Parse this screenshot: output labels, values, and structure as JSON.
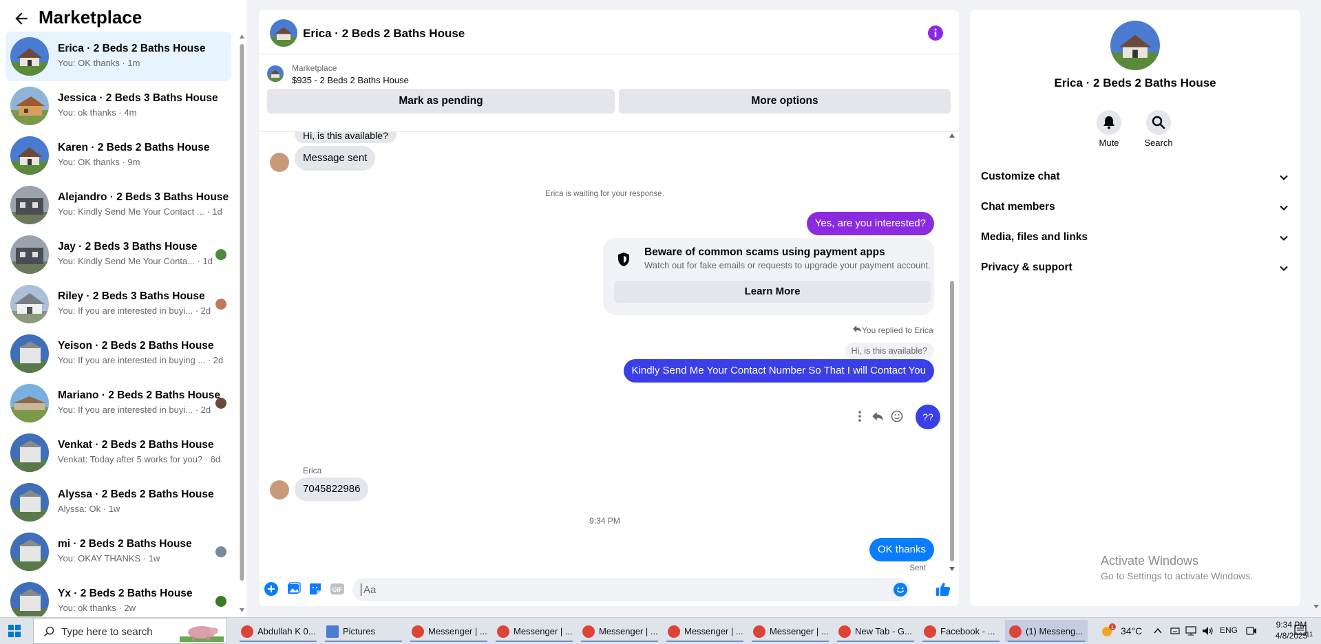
{
  "sidebar": {
    "title": "Marketplace",
    "conversations": [
      {
        "name": "Erica · 2 Beds 2 Baths House",
        "preview": "You: OK thanks · 1m"
      },
      {
        "name": "Jessica · 2 Beds 3 Baths House",
        "preview": "You: ok thanks · 4m"
      },
      {
        "name": "Karen · 2 Beds 2 Baths House",
        "preview": "You: OK thanks · 9m"
      },
      {
        "name": "Alejandro · 2 Beds 3 Baths House",
        "preview": "You: Kindly Send Me Your Contact ... · 1d"
      },
      {
        "name": "Jay · 2 Beds 3 Baths House",
        "preview": "You: Kindly Send Me Your Conta... · 1d"
      },
      {
        "name": "Riley · 2 Beds 3 Baths House",
        "preview": "You: If you are interested in buyi... · 2d"
      },
      {
        "name": "Yeison · 2 Beds 2 Baths House",
        "preview": "You: If you are interested in buying ... · 2d"
      },
      {
        "name": "Mariano · 2 Beds 2 Baths House",
        "preview": "You: If you are interested in buyi... · 2d"
      },
      {
        "name": "Venkat · 2 Beds 2 Baths House",
        "preview": "Venkat: Today after 5 works for you? · 6d"
      },
      {
        "name": "Alyssa · 2 Beds 2 Baths House",
        "preview": "Alyssa: Ok · 1w"
      },
      {
        "name": "mi · 2 Beds 2 Baths House",
        "preview": "You: OKAY THANKS · 1w"
      },
      {
        "name": "Yx · 2 Beds 2 Baths House",
        "preview": "You: ok thanks · 2w"
      }
    ]
  },
  "chat": {
    "title": "Erica · 2 Beds 2 Baths House",
    "listing_kind": "Marketplace",
    "listing_title": "$935 - 2 Beds 2 Baths House",
    "mark_pending": "Mark as pending",
    "more_options": "More options",
    "messages": {
      "partial_top": "Hi, is this available?",
      "message_sent": "Message sent",
      "waiting": "Erica is waiting for your response.",
      "yes_interested": "Yes, are you interested?",
      "scam_title": "Beware of common scams using payment apps",
      "scam_body": "Watch out for fake emails or requests to upgrade your payment account.",
      "learn_more": "Learn More",
      "replied_to": "You replied to Erica",
      "quoted": "Hi, is this available?",
      "kindly": "Kindly Send Me Your Contact Number So That I will Contact You",
      "reaction_bubble": "??",
      "sender_erica": "Erica",
      "phone": "7045822986",
      "time": "9:34 PM",
      "ok_thanks": "OK thanks",
      "sent": "Sent"
    },
    "composer_placeholder": "Aa"
  },
  "info": {
    "title": "Erica · 2 Beds 2 Baths House",
    "mute": "Mute",
    "search": "Search",
    "sections": [
      "Customize chat",
      "Chat members",
      "Media, files and links",
      "Privacy & support"
    ]
  },
  "watermark": {
    "line1": "Activate Windows",
    "line2": "Go to Settings to activate Windows."
  },
  "taskbar": {
    "search_placeholder": "Type here to search",
    "apps": [
      "Abdullah K 0...",
      "Pictures",
      "Messenger | ...",
      "Messenger | ...",
      "Messenger | ...",
      "Messenger | ...",
      "Messenger | ...",
      "New Tab - G...",
      "Facebook - ...",
      "(1) Messeng..."
    ],
    "temperature": "34°C",
    "language": "ENG",
    "time": "9:34 PM",
    "date": "4/8/2025",
    "notifications": "11"
  },
  "colors": {
    "purple": "#8a2be2",
    "blue": "#3a3fe8",
    "messenger_blue": "#0a7cff",
    "fb_blue": "#1877f2"
  }
}
